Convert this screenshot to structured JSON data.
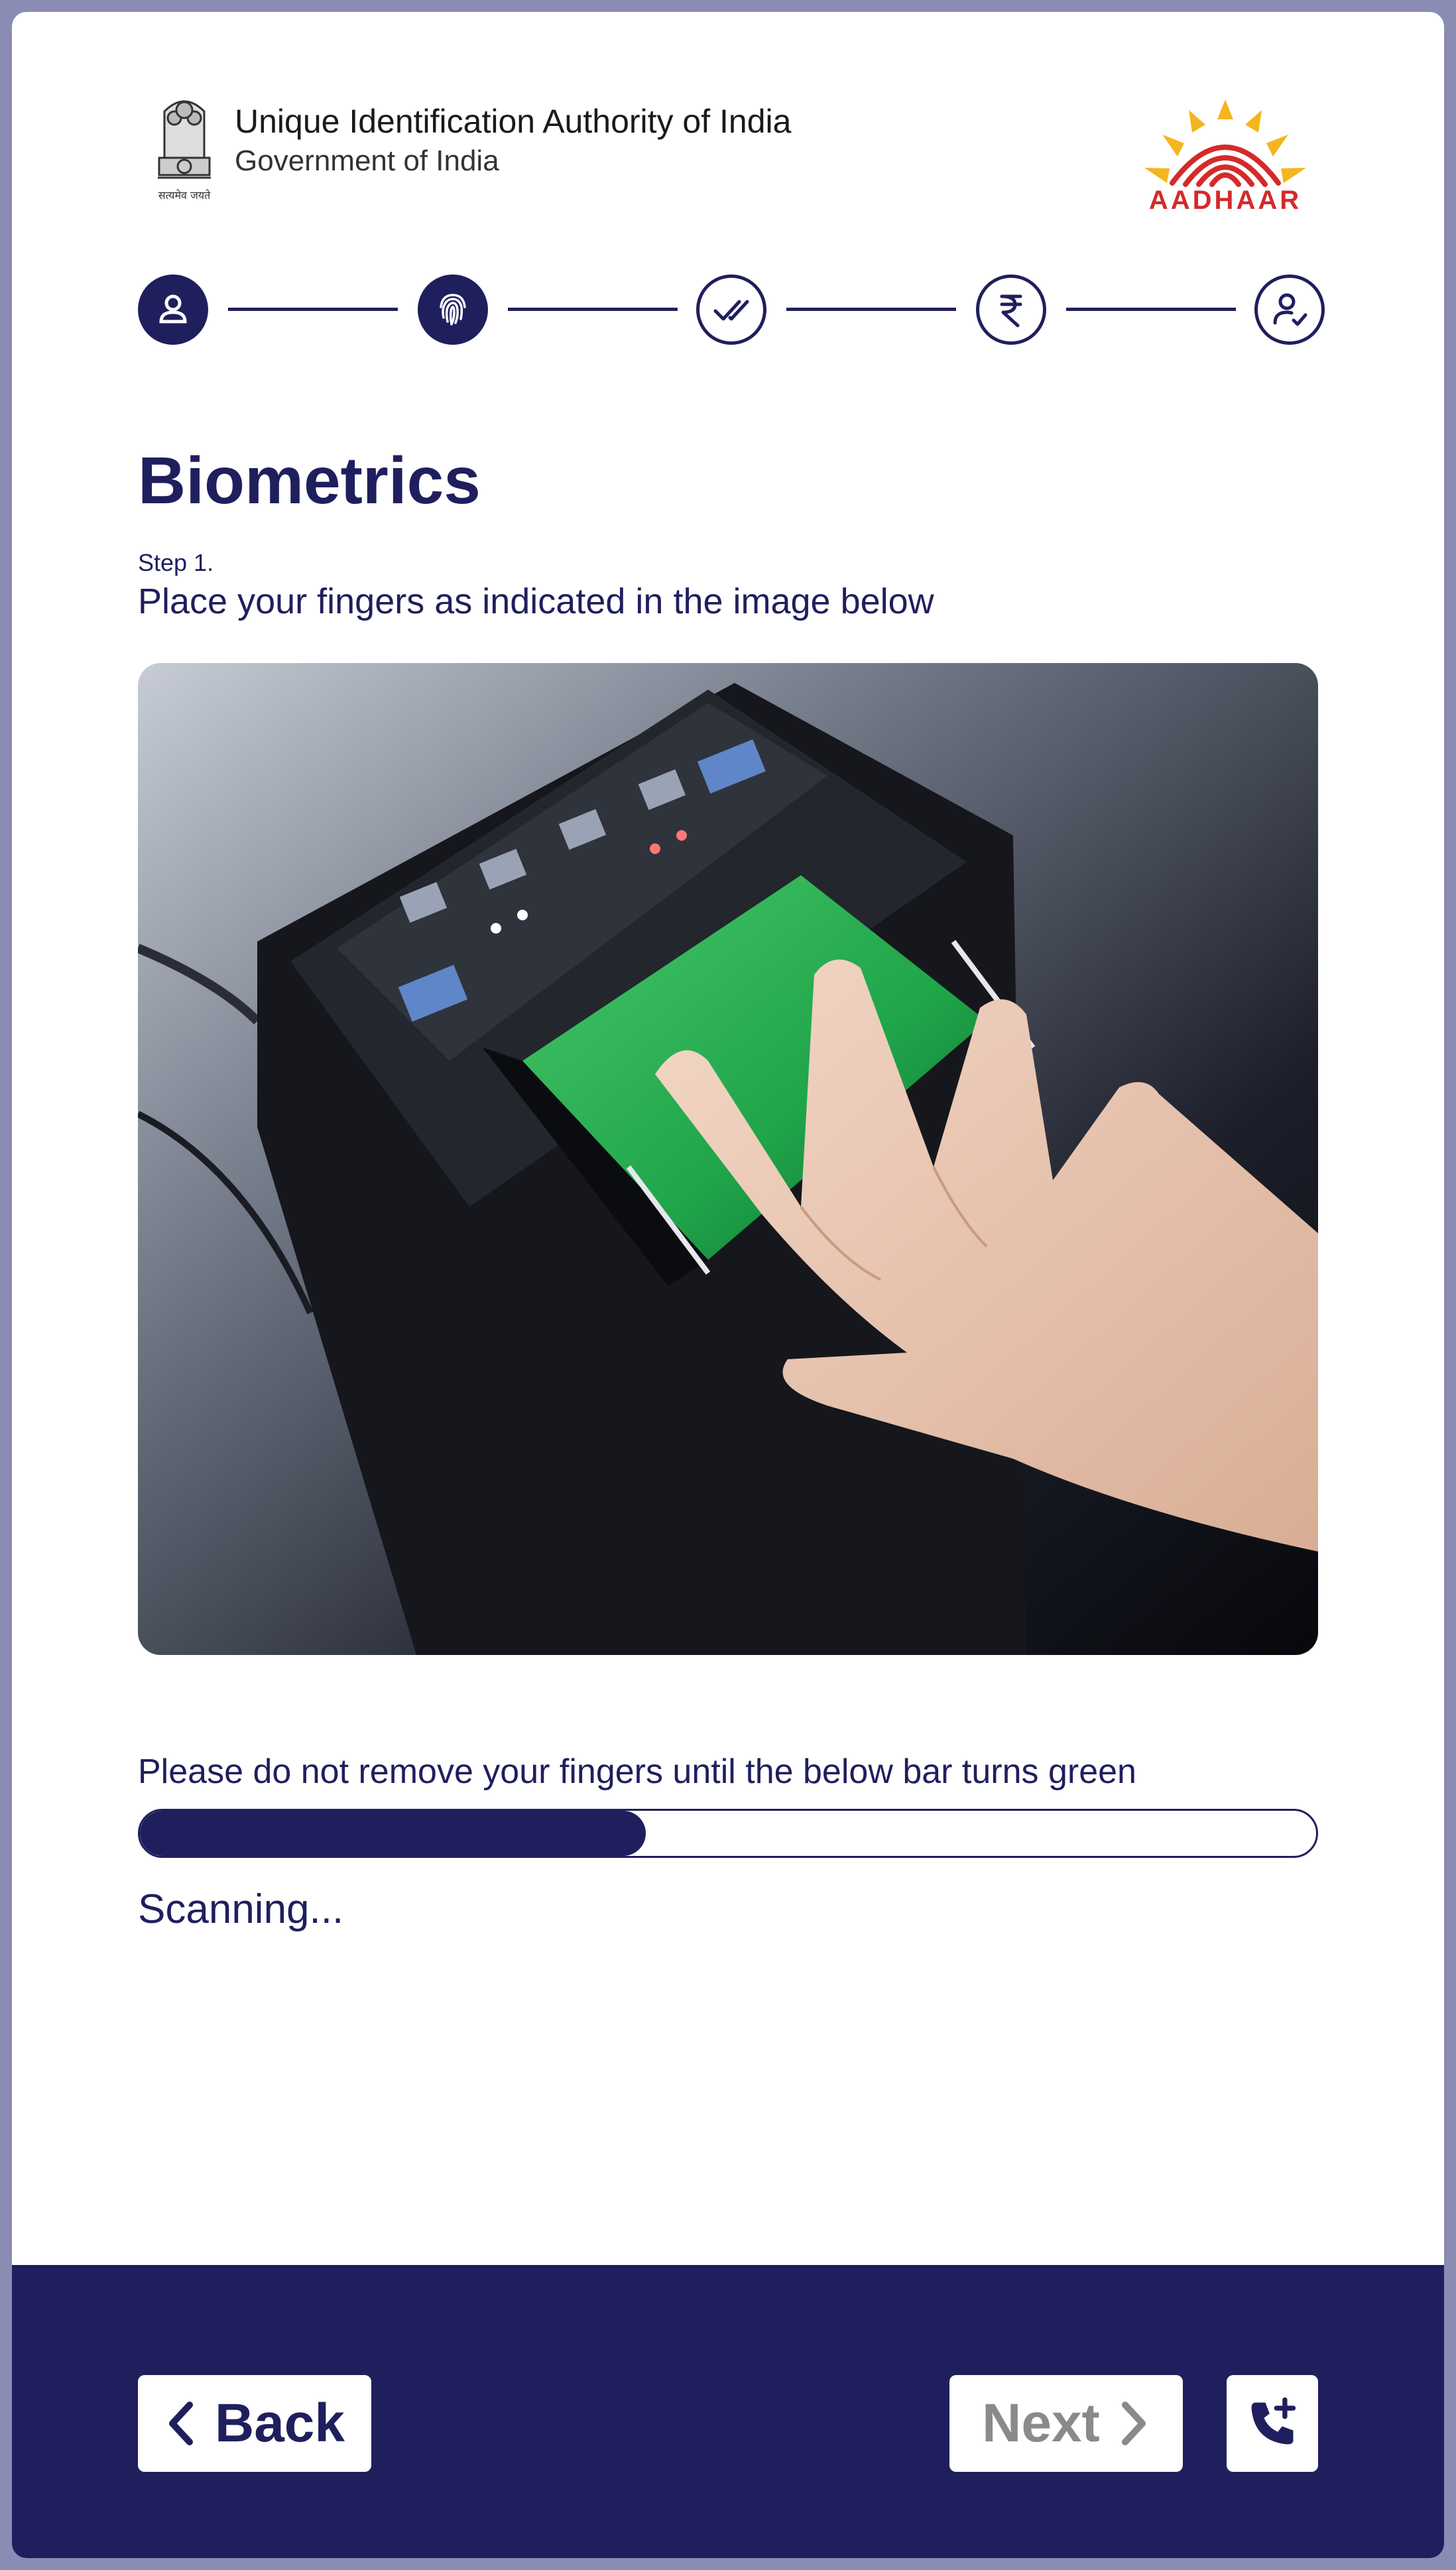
{
  "header": {
    "org_name": "Unique Identification Authority of India",
    "org_sub": "Government of India",
    "emblem_icon": "national-emblem-icon",
    "emblem_motto": "सत्यमेव जयते",
    "logo_text": "AADHAAR"
  },
  "stepper": {
    "steps": [
      {
        "icon": "person-icon",
        "state": "completed"
      },
      {
        "icon": "fingerprint-icon",
        "state": "current"
      },
      {
        "icon": "double-check-icon",
        "state": "upcoming"
      },
      {
        "icon": "rupee-icon",
        "state": "upcoming"
      },
      {
        "icon": "user-check-icon",
        "state": "upcoming"
      }
    ]
  },
  "main": {
    "title": "Biometrics",
    "step_label": "Step 1.",
    "step_description": "Place your fingers as indicated in the image below",
    "image_icon": "fingerprint-scanner-photo",
    "instruction": "Please do not remove your fingers until the below bar turns green",
    "progress": 0.43,
    "status": "Scanning..."
  },
  "footer": {
    "back_label": "Back",
    "next_label": "Next",
    "call_icon": "phone-add-icon"
  },
  "colors": {
    "primary": "#1f1f5e",
    "frame": "#8a8cb4",
    "disabled_text": "#8a8a8a",
    "logo_red": "#d42a2a",
    "logo_yellow": "#f5b51f"
  }
}
